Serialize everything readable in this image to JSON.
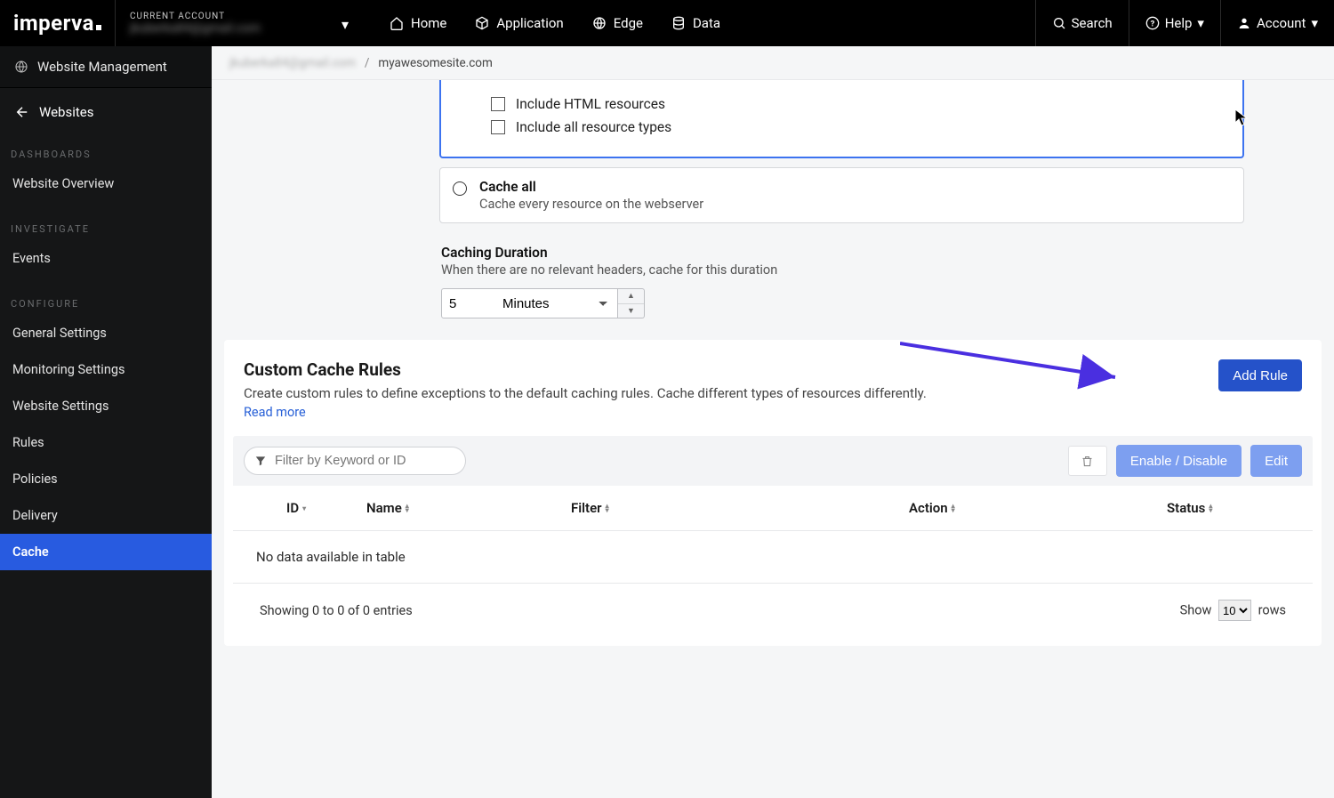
{
  "brand": "imperva",
  "account_picker": {
    "label": "CURRENT ACCOUNT",
    "email_masked": "jkuberka84@gmail.com"
  },
  "topnav": {
    "home": "Home",
    "application": "Application",
    "edge": "Edge",
    "data": "Data"
  },
  "topright": {
    "search": "Search",
    "help": "Help",
    "account": "Account"
  },
  "sidebar": {
    "header": "Website Management",
    "back": "Websites",
    "sections": {
      "dashboards": {
        "label": "DASHBOARDS",
        "items": [
          "Website Overview"
        ]
      },
      "investigate": {
        "label": "INVESTIGATE",
        "items": [
          "Events"
        ]
      },
      "configure": {
        "label": "CONFIGURE",
        "items": [
          "General Settings",
          "Monitoring Settings",
          "Website Settings",
          "Rules",
          "Policies",
          "Delivery",
          "Cache"
        ]
      }
    },
    "active": "Cache"
  },
  "breadcrumb": {
    "email_masked": "jkuberka84@gmail.com",
    "site": "myawesomesite.com"
  },
  "cache_options": {
    "include_html": "Include HTML resources",
    "include_all": "Include all resource types",
    "cache_all_title": "Cache all",
    "cache_all_sub": "Cache every resource on the webserver"
  },
  "caching_duration": {
    "title": "Caching Duration",
    "sub": "When there are no relevant headers, cache for this duration",
    "value": "5",
    "unit": "Minutes"
  },
  "rules": {
    "title": "Custom Cache Rules",
    "sub": "Create custom rules to define exceptions to the default caching rules. Cache different types of resources differently.",
    "read_more": "Read more",
    "add_btn": "Add Rule",
    "filter_placeholder": "Filter by Keyword or ID",
    "enable_disable": "Enable / Disable",
    "edit": "Edit",
    "columns": {
      "id": "ID",
      "name": "Name",
      "filter": "Filter",
      "action": "Action",
      "status": "Status"
    },
    "empty": "No data available in table",
    "footer_info": "Showing 0 to 0 of 0 entries",
    "show_label_pre": "Show",
    "show_value": "10",
    "show_label_post": "rows"
  }
}
